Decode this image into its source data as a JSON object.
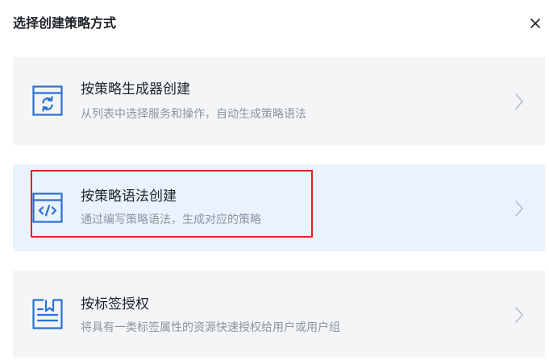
{
  "dialog": {
    "title": "选择创建策略方式",
    "close_glyph": "×"
  },
  "options": [
    {
      "title": "按策略生成器创建",
      "description": "从列表中选择服务和操作，自动生成策略语法",
      "icon": "refresh-window-icon"
    },
    {
      "title": "按策略语法创建",
      "description": "通过编写策略语法，生成对应的策略",
      "icon": "code-window-icon",
      "selected": true
    },
    {
      "title": "按标签授权",
      "description": "将具有一类标签属性的资源快速授权给用户或用户组",
      "icon": "tag-document-icon"
    }
  ],
  "colors": {
    "accent": "#2b6fd6",
    "highlight": "#e02020",
    "card_bg": "#f3f5f7",
    "card_selected_bg": "#e9f3fe"
  }
}
